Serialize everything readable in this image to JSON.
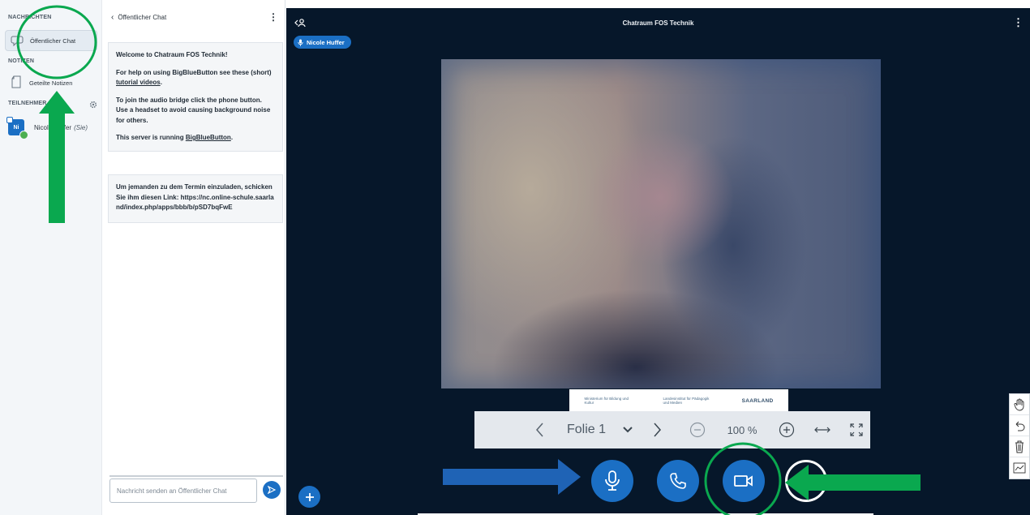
{
  "userlist": {
    "messages_title": "NACHRICHTEN",
    "public_chat": "Öffentlicher Chat",
    "notes_title": "NOTIZEN",
    "shared_notes": "Geteilte Notizen",
    "participants_title": "TEILNEHMER (1)",
    "user_initials": "Ni",
    "user_name": "Nicole Huffer",
    "user_you": "(Sie)"
  },
  "chat": {
    "header": "Öffentlicher Chat",
    "welcome_title": "Welcome to Chatraum FOS Technik!",
    "help_before": "For help on using BigBlueButton see these (short) ",
    "help_link": "tutorial videos",
    "help_after": ".",
    "audio_hint": "To join the audio bridge click the phone button. Use a headset to avoid causing background noise for others.",
    "server_before": "This server is running ",
    "server_link": "BigBlueButton",
    "server_after": ".",
    "invite_text": "Um jemanden zu dem Termin einzuladen, schicken Sie ihm diesen Link: https://nc.online-schule.saarland/index.php/apps/bbb/b/pSD7bqFwE",
    "input_placeholder": "Nachricht senden an Öffentlicher Chat"
  },
  "main": {
    "room_title": "Chatraum FOS Technik",
    "talker": "Nicole Huffer",
    "slide_logo_left": "Ministerium für Bildung und Kultur",
    "slide_logo_mid": "Landesinstitut für Pädagogik und Medien",
    "slide_logo_right": "SAARLAND",
    "slide_label": "Folie 1",
    "zoom": "100 %"
  },
  "colors": {
    "accent": "#1b6fc4",
    "main_bg": "#06172a",
    "annotation_green": "#0aa84f",
    "annotation_blue": "#1f63b5"
  },
  "icons": {
    "public_chat": "chat-bubble-icon",
    "shared_notes": "notes-icon",
    "participants_settings": "gear-icon",
    "send": "send-icon",
    "mic": "microphone-icon",
    "phone": "phone-icon",
    "camera": "camera-icon",
    "screenshare": "screenshare-icon",
    "plus": "plus-icon"
  }
}
